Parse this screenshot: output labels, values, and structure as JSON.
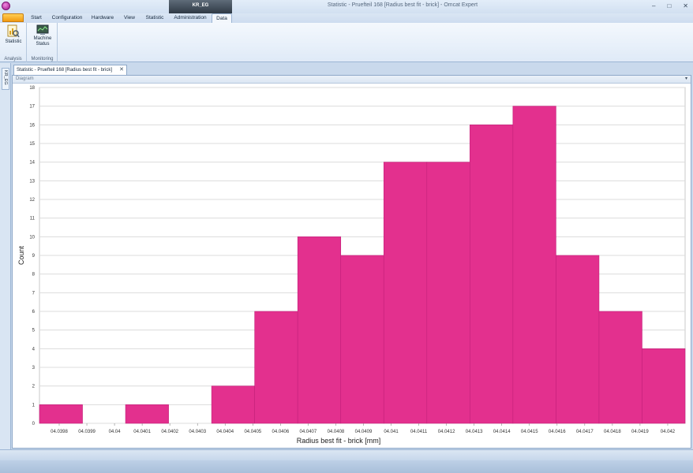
{
  "window": {
    "title": "Statistic - Pruefteil 168 [Radius best fit - brick] - Omcat Expert",
    "context_tab": "KR_EG",
    "controls": [
      "–",
      "□",
      "✕"
    ]
  },
  "ribbon": {
    "file_label": "",
    "tabs": [
      "Start",
      "Configuration",
      "Hardware",
      "View",
      "Statistic",
      "Administration",
      "Data"
    ],
    "active_tab": "Data",
    "groups": [
      {
        "label": "Analysis",
        "buttons": [
          {
            "label": "Statistic",
            "icon": "statistic-icon"
          }
        ]
      },
      {
        "label": "Monitoring",
        "buttons": [
          {
            "label": "Machine Status",
            "icon": "machine-status-icon"
          }
        ]
      }
    ]
  },
  "side_strip": {
    "label": "KR_EG"
  },
  "document_tab": {
    "label": "Statistic - Pruefteil 168 [Radius best fit - brick]",
    "close": "✕"
  },
  "panel": {
    "title": "Diagram",
    "pin": "▾"
  },
  "colors": {
    "bar": "#e3308e",
    "bar_edge": "#c2207a",
    "grid": "#dcdcdc"
  },
  "chart_data": {
    "type": "bar",
    "xlabel": "Radius best fit - brick [mm]",
    "ylabel": "Count",
    "ylim": [
      0,
      18
    ],
    "yticks": [
      "0",
      "1",
      "2",
      "3",
      "4",
      "5",
      "6",
      "7",
      "8",
      "9",
      "10",
      "11",
      "12",
      "13",
      "14",
      "15",
      "16",
      "17",
      "18"
    ],
    "xticks": [
      "04.0398",
      "04.0399",
      "04.04",
      "04.0401",
      "04.0402",
      "04.0403",
      "04.0404",
      "04.0405",
      "04.0406",
      "04.0407",
      "04.0408",
      "04.0409",
      "04.041",
      "04.0411",
      "04.0412",
      "04.0413",
      "04.0414",
      "04.0415",
      "04.0416",
      "04.0417",
      "04.0418",
      "04.0419",
      "04.042"
    ],
    "bins": [
      {
        "value": 1
      },
      {
        "value": 0
      },
      {
        "value": 1
      },
      {
        "value": 0
      },
      {
        "value": 2
      },
      {
        "value": 6
      },
      {
        "value": 10
      },
      {
        "value": 9
      },
      {
        "value": 14
      },
      {
        "value": 14
      },
      {
        "value": 16
      },
      {
        "value": 17
      },
      {
        "value": 9
      },
      {
        "value": 6
      },
      {
        "value": 4
      }
    ],
    "grid": true
  }
}
